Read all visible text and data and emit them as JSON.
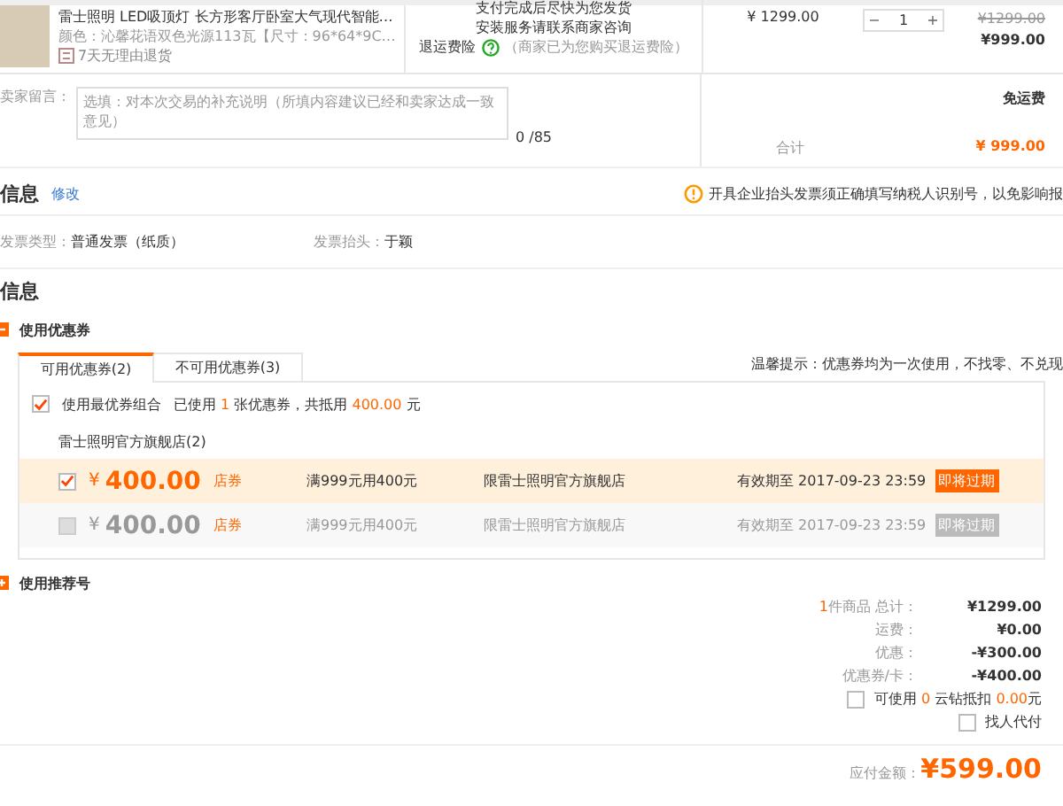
{
  "product": {
    "title": "雷士照明 LED吸顶灯 长方形客厅卧室大气现代智能…",
    "spec": "颜色：沁馨花语双色光源113瓦【尺寸：96*64*9C…",
    "service": "7天无理由退货",
    "notes": [
      "支付完成后尽快为您发货",
      "安装服务请联系商家咨询"
    ],
    "insurance_label": "退运费险",
    "insurance_note": "（商家已为您购买退运费险）",
    "unit_price": "¥ 1299.00",
    "decrement": "−",
    "quantity": "1",
    "increment": "+",
    "original_price": "¥1299.00",
    "price": "¥999.00"
  },
  "message": {
    "label": "卖家留言：",
    "placeholder": "选填：对本次交易的补充说明（所填内容建议已经和卖家达成一致意见）",
    "counter": "0 /85",
    "shipping": "免运费",
    "total_label": "合计",
    "total": "¥ 999.00"
  },
  "invoice": {
    "title": "信息",
    "edit_link": "修改",
    "warning": "开具企业抬头发票须正确填写纳税人识别号，以免影响报",
    "type_label": "发票类型：",
    "type_value": "普通发票（纸质）",
    "header_label": "发票抬头：",
    "header_value": "于颖"
  },
  "info_title": "信息",
  "coupons": {
    "title": "使用优惠券",
    "expanded": true,
    "tabs": [
      {
        "label": "可用优惠券(2)",
        "selected": true
      },
      {
        "label": "不可用优惠券(3)",
        "selected": false
      }
    ],
    "hint": "温馨提示：优惠券均为一次使用，不找零、不兑现",
    "best_combo": {
      "checked": true,
      "label": "使用最优券组合",
      "summary": [
        {
          "text": "已使用 ",
          "highlight": false
        },
        {
          "text": "1",
          "highlight": true
        },
        {
          "text": " 张优惠券，共抵用 ",
          "highlight": false
        },
        {
          "text": "400.00",
          "highlight": true
        },
        {
          "text": " 元",
          "highlight": false
        }
      ]
    },
    "store": "雷士照明官方旗舰店(2)",
    "items": [
      {
        "checked": true,
        "disabled": false,
        "currency": "¥",
        "amount": "400.00",
        "type": "店券",
        "condition": "满999元用400元",
        "scope": "限雷士照明官方旗舰店",
        "validity": "有效期至 2017-09-23 23:59",
        "badge": "即将过期"
      },
      {
        "checked": false,
        "disabled": true,
        "currency": "¥",
        "amount": "400.00",
        "type": "店券",
        "condition": "满999元用400元",
        "scope": "限雷士照明官方旗舰店",
        "validity": "有效期至 2017-09-23 23:59",
        "badge": "即将过期"
      }
    ]
  },
  "referral": {
    "title": "使用推荐号",
    "expanded": false
  },
  "summary": {
    "count": "1",
    "rows": [
      {
        "label": "件商品 总计：",
        "value": "¥1299.00"
      },
      {
        "label": "运费：",
        "value": "¥0.00"
      },
      {
        "label": "优惠：",
        "value": "-¥300.00"
      },
      {
        "label": "优惠券/卡：",
        "value": "-¥400.00"
      }
    ],
    "points": {
      "checked": false,
      "parts": [
        {
          "text": "可使用 ",
          "highlight": false
        },
        {
          "text": "0",
          "highlight": true
        },
        {
          "text": " 云钻抵扣 ",
          "highlight": false
        },
        {
          "text": "0.00",
          "highlight": true
        },
        {
          "text": "元",
          "highlight": false
        }
      ]
    },
    "proxy": {
      "checked": false,
      "label": "找人代付"
    },
    "due_label": "应付金额：",
    "due": "¥599.00"
  }
}
